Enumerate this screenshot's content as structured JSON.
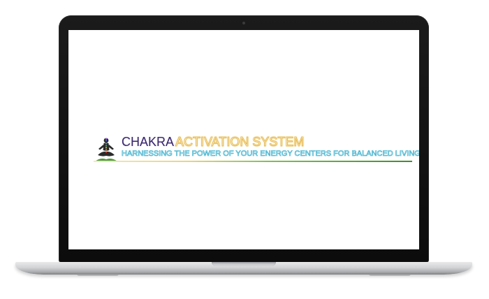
{
  "logo": {
    "title_main": "CHAKRA",
    "title_accent": "ACTIVATION SYSTEM",
    "tagline": "HARNESSING THE POWER OF YOUR ENERGY CENTERS FOR BALANCED LIVING",
    "icon": "meditating-figure-icon"
  },
  "colors": {
    "title_main": "#3c2a6e",
    "title_accent_outline": "#e6b84a",
    "tagline_outline": "#2ea9c8",
    "underline_gradient": [
      "#f3e9b8",
      "#e9d57a",
      "#7fc24d",
      "#3d8f2b"
    ],
    "bezel": "#111111",
    "screen": "#ffffff"
  }
}
